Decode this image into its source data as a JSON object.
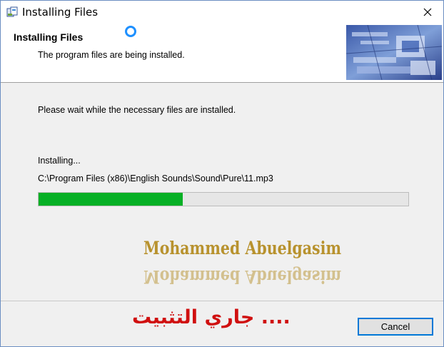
{
  "window": {
    "title": "Installing Files",
    "app_icon": "installer-icon",
    "close_icon": "close-icon"
  },
  "header": {
    "title": "Installing Files",
    "subtitle": "The program files are being installed."
  },
  "main": {
    "instruction": "Please wait while the necessary files are installed.",
    "status_label": "Installing...",
    "current_file": "C:\\Program Files (x86)\\English Sounds\\Sound\\Pure\\11.mp3",
    "progress_fraction": 0.39
  },
  "watermark": {
    "text": "Mohammed Abuelgasim"
  },
  "footer": {
    "arabic_text": "جاري التثبيت ....",
    "cancel_label": "Cancel"
  },
  "colors": {
    "progress_fill": "#06b025",
    "watermark": "#b8922e",
    "arabic": "#d01010",
    "button_border": "#0078d7"
  }
}
